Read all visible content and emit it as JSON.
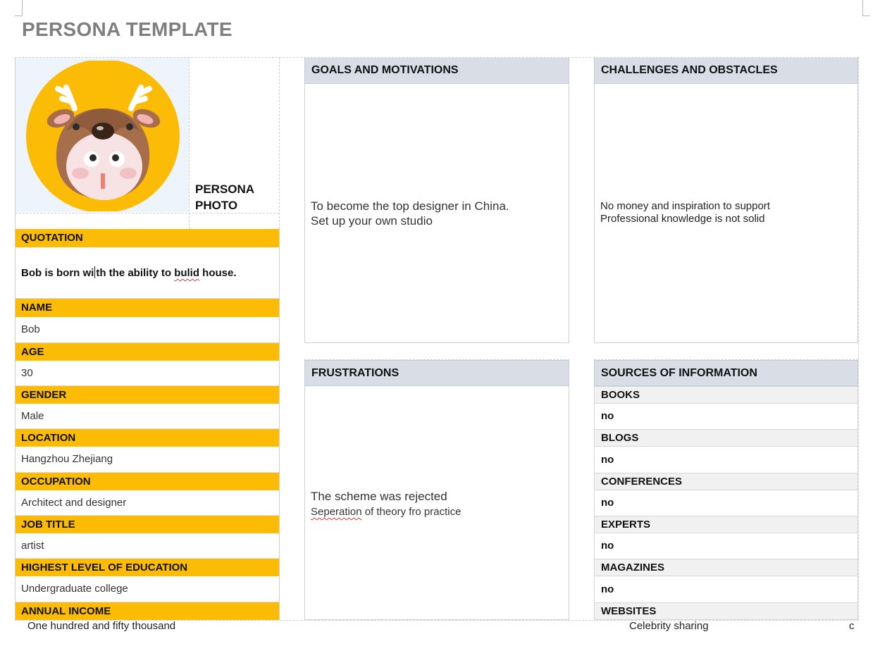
{
  "title": "PERSONA TEMPLATE",
  "photo_label": "PERSONA PHOTO",
  "photo_label_line1": "PERSONA",
  "photo_label_line2": "PHOTO",
  "quotation": {
    "label": "QUOTATION",
    "value_part1": "Bob is born wi",
    "value_part2": "th the ability to ",
    "value_misspelled": "bulid",
    "value_part3": " house."
  },
  "fields": [
    {
      "label": "NAME",
      "value": "Bob"
    },
    {
      "label": "AGE",
      "value": "30"
    },
    {
      "label": "GENDER",
      "value": "Male"
    },
    {
      "label": "LOCATION",
      "value": "Hangzhou Zhejiang"
    },
    {
      "label": "OCCUPATION",
      "value": "Architect and designer"
    },
    {
      "label": "JOB TITLE",
      "value": "artist"
    },
    {
      "label": "HIGHEST LEVEL OF EDUCATION",
      "value": "Undergraduate college"
    },
    {
      "label": "ANNUAL INCOME",
      "value": "One hundred and fifty thousand"
    }
  ],
  "goals": {
    "header": "GOALS AND MOTIVATIONS",
    "line1": "To become the top designer in China.",
    "line2": "Set up your own studio"
  },
  "challenges": {
    "header": "CHALLENGES AND OBSTACLES",
    "line1": "No money and inspiration to support",
    "line2": "Professional knowledge is not solid"
  },
  "frustrations": {
    "header": "FRUSTRATIONS",
    "line1": "The scheme was rejected",
    "line2_misspelled": "Seperation",
    "line2_rest": " of theory fro practice"
  },
  "sources": {
    "header": "SOURCES OF INFORMATION",
    "items": [
      {
        "label": "BOOKS",
        "value": "no"
      },
      {
        "label": "BLOGS",
        "value": "no"
      },
      {
        "label": "CONFERENCES",
        "value": "no"
      },
      {
        "label": "EXPERTS",
        "value": "no"
      },
      {
        "label": "MAGAZINES",
        "value": "no"
      },
      {
        "label": "WEBSITES",
        "value": "Celebrity sharing"
      }
    ]
  },
  "footer_stray": "c",
  "colors": {
    "accent_yellow": "#fcbb04",
    "header_gray": "#d8dde6",
    "title_gray": "#7f7f7f",
    "source_header_bg": "#f1f1f1"
  },
  "icons": {
    "persona_photo": "deer-costume-child-avatar"
  }
}
